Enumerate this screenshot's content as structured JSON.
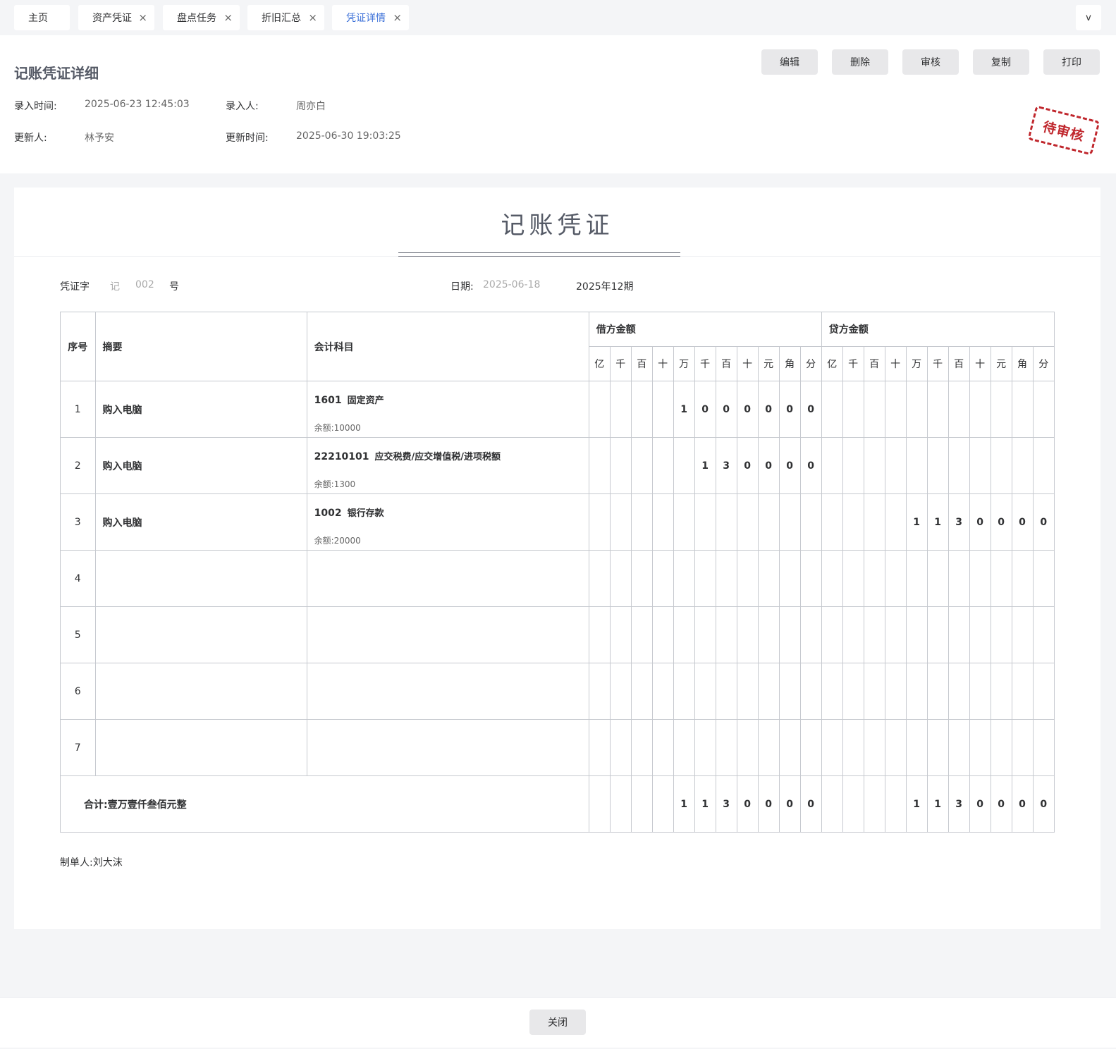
{
  "tabs": [
    {
      "label": "主页",
      "closable": false,
      "active": false
    },
    {
      "label": "资产凭证",
      "closable": true,
      "active": false
    },
    {
      "label": "盘点任务",
      "closable": true,
      "active": false
    },
    {
      "label": "折旧汇总",
      "closable": true,
      "active": false
    },
    {
      "label": "凭证详情",
      "closable": true,
      "active": true
    }
  ],
  "tab_close_glyph": "×",
  "tab_more_glyph": "v",
  "header": {
    "title": "记账凭证详细",
    "entry_time_label": "录入时间:",
    "entry_time": "2025-06-23 12:45:03",
    "entry_user_label": "录入人:",
    "entry_user": "周亦白",
    "updater_label": "更新人:",
    "updater": "林予安",
    "update_time_label": "更新时间:",
    "update_time": "2025-06-30 19:03:25",
    "stamp": "待审核",
    "stamp_color": "#c0272d"
  },
  "actions": {
    "edit": "编辑",
    "delete": "删除",
    "review": "审核",
    "copy": "复制",
    "print": "打印"
  },
  "voucher": {
    "title": "记账凭证",
    "word_label": "凭证字",
    "word": "记",
    "number": "002",
    "number_suffix": "号",
    "date_label": "日期:",
    "date": "2025-06-18",
    "period": "2025年12期",
    "columns": {
      "seq": "序号",
      "summary": "摘要",
      "account": "会计科目",
      "debit": "借方金额",
      "credit": "贷方金额"
    },
    "units": [
      "亿",
      "千",
      "百",
      "十",
      "万",
      "千",
      "百",
      "十",
      "元",
      "角",
      "分"
    ],
    "rows": [
      {
        "seq": "1",
        "summary": "购入电脑",
        "code": "1601",
        "name": "固定资产",
        "balance": "余额:10000",
        "debit": [
          "",
          "",
          "",
          "",
          "1",
          "0",
          "0",
          "0",
          "0",
          "0",
          "0"
        ],
        "credit": [
          "",
          "",
          "",
          "",
          "",
          "",
          "",
          "",
          "",
          "",
          ""
        ]
      },
      {
        "seq": "2",
        "summary": "购入电脑",
        "code": "22210101",
        "name": "应交税费/应交增值税/进项税额",
        "balance": "余额:1300",
        "debit": [
          "",
          "",
          "",
          "",
          "",
          "1",
          "3",
          "0",
          "0",
          "0",
          "0"
        ],
        "credit": [
          "",
          "",
          "",
          "",
          "",
          "",
          "",
          "",
          "",
          "",
          ""
        ]
      },
      {
        "seq": "3",
        "summary": "购入电脑",
        "code": "1002",
        "name": "银行存款",
        "balance": "余额:20000",
        "debit": [
          "",
          "",
          "",
          "",
          "",
          "",
          "",
          "",
          "",
          "",
          ""
        ],
        "credit": [
          "",
          "",
          "",
          "",
          "1",
          "1",
          "3",
          "0",
          "0",
          "0",
          "0"
        ]
      },
      {
        "seq": "4",
        "summary": "",
        "code": "",
        "name": "",
        "balance": "",
        "debit": [
          "",
          "",
          "",
          "",
          "",
          "",
          "",
          "",
          "",
          "",
          ""
        ],
        "credit": [
          "",
          "",
          "",
          "",
          "",
          "",
          "",
          "",
          "",
          "",
          ""
        ]
      },
      {
        "seq": "5",
        "summary": "",
        "code": "",
        "name": "",
        "balance": "",
        "debit": [
          "",
          "",
          "",
          "",
          "",
          "",
          "",
          "",
          "",
          "",
          ""
        ],
        "credit": [
          "",
          "",
          "",
          "",
          "",
          "",
          "",
          "",
          "",
          "",
          ""
        ]
      },
      {
        "seq": "6",
        "summary": "",
        "code": "",
        "name": "",
        "balance": "",
        "debit": [
          "",
          "",
          "",
          "",
          "",
          "",
          "",
          "",
          "",
          "",
          ""
        ],
        "credit": [
          "",
          "",
          "",
          "",
          "",
          "",
          "",
          "",
          "",
          "",
          ""
        ]
      },
      {
        "seq": "7",
        "summary": "",
        "code": "",
        "name": "",
        "balance": "",
        "debit": [
          "",
          "",
          "",
          "",
          "",
          "",
          "",
          "",
          "",
          "",
          ""
        ],
        "credit": [
          "",
          "",
          "",
          "",
          "",
          "",
          "",
          "",
          "",
          "",
          ""
        ]
      }
    ],
    "total_label": "合计:",
    "total_words": "壹万壹仟叁佰元整",
    "total_debit": [
      "",
      "",
      "",
      "",
      "1",
      "1",
      "3",
      "0",
      "0",
      "0",
      "0"
    ],
    "total_credit": [
      "",
      "",
      "",
      "",
      "1",
      "1",
      "3",
      "0",
      "0",
      "0",
      "0"
    ],
    "maker_label": "制单人:",
    "maker": "刘大沫"
  },
  "footer": {
    "close": "关闭"
  }
}
